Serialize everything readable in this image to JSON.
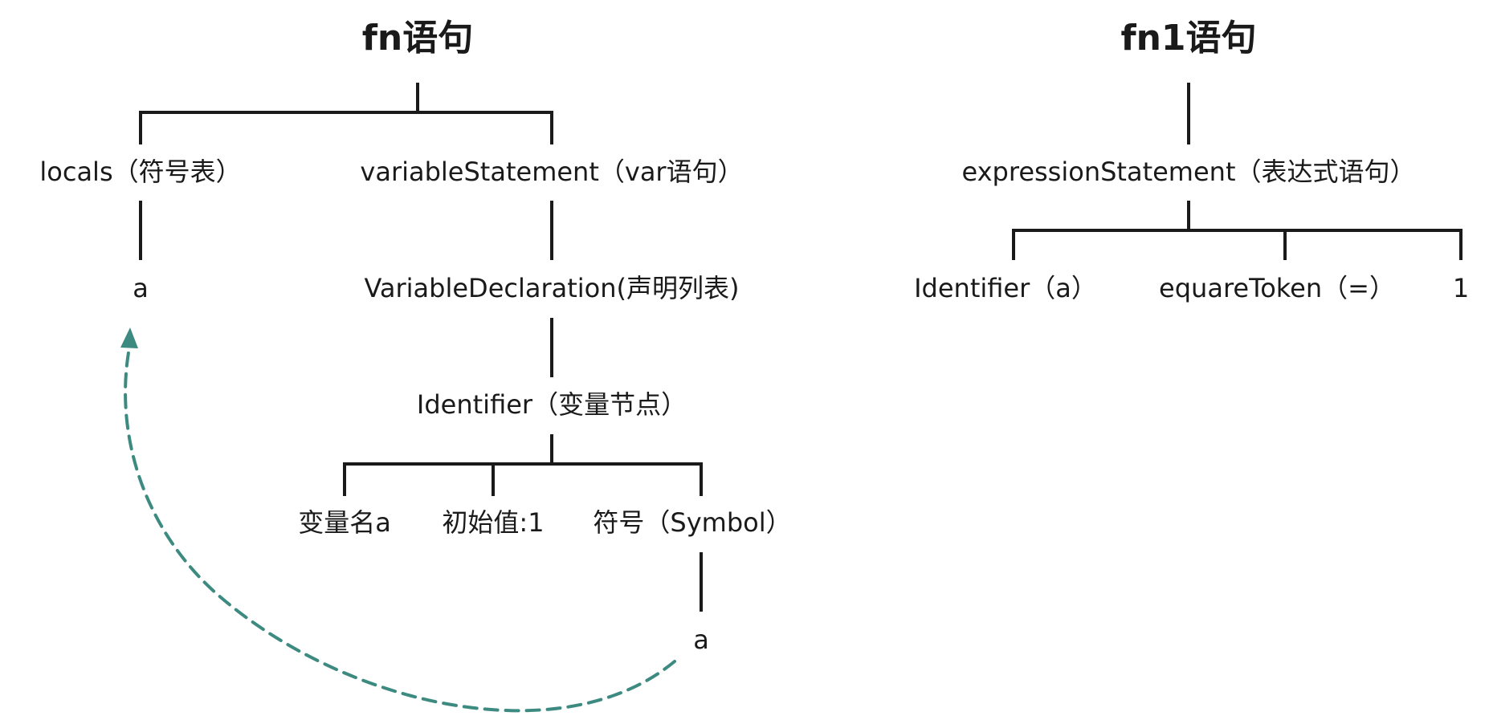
{
  "left_tree": {
    "title": "fn语句",
    "locals": "locals（符号表）",
    "locals_child": "a",
    "variable_statement": "variableStatement（var语句）",
    "variable_declaration": "VariableDeclaration(声明列表)",
    "identifier": "Identifier（变量节点）",
    "var_name": "变量名a",
    "initial_value": "初始值:1",
    "symbol": "符号（Symbol）",
    "symbol_child": "a"
  },
  "right_tree": {
    "title": "fn1语句",
    "expression_statement": "expressionStatement（表达式语句）",
    "identifier": "Identifier（a）",
    "equals_token": "equareToken（=）",
    "literal": "1"
  },
  "colors": {
    "lines": "#1a1a1a",
    "reference_arrow": "#3d8a80"
  }
}
